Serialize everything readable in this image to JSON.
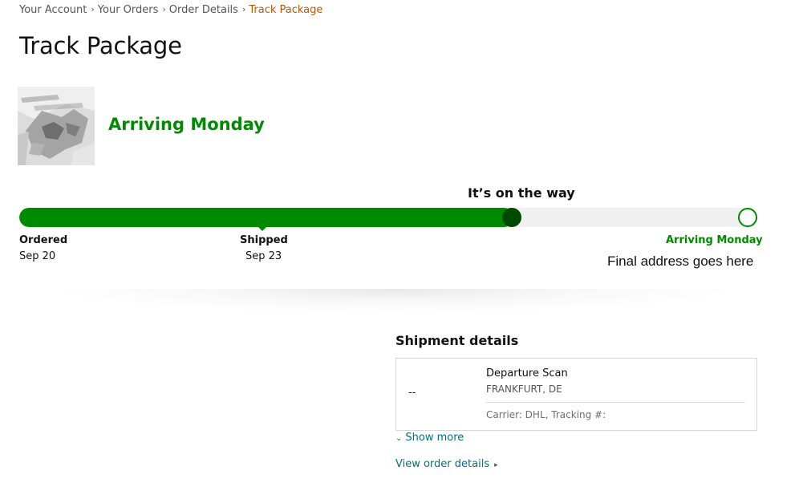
{
  "breadcrumb": {
    "items": [
      "Your Account",
      "Your Orders",
      "Order Details"
    ],
    "current": "Track Package",
    "separator": "›"
  },
  "page_title": "Track Package",
  "product": {
    "image_icon": "product-thumbnail"
  },
  "arrival": {
    "headline": "Arriving Monday",
    "status_title": "It’s on the way",
    "final_address": "Final address goes here"
  },
  "progress": {
    "fraction_complete": 0.67,
    "steps": [
      {
        "label": "Ordered",
        "date": "Sep 20"
      },
      {
        "label": "Shipped",
        "date": "Sep 23"
      },
      {
        "label": "Arriving Monday",
        "date": ""
      }
    ],
    "colors": {
      "fill": "#008a00",
      "marker": "#004a00",
      "track": "#f0f0f0"
    }
  },
  "shipment": {
    "title": "Shipment details",
    "events": [
      {
        "time": "--",
        "title": "Departure Scan",
        "location": "FRANKFURT, DE"
      }
    ],
    "carrier_info": "Carrier: DHL, Tracking #:",
    "show_more_label": "Show more",
    "view_order_label": "View order details"
  },
  "colors": {
    "accent_green": "#008a00",
    "link": "#007185",
    "breadcrumb_current": "#c45500"
  }
}
